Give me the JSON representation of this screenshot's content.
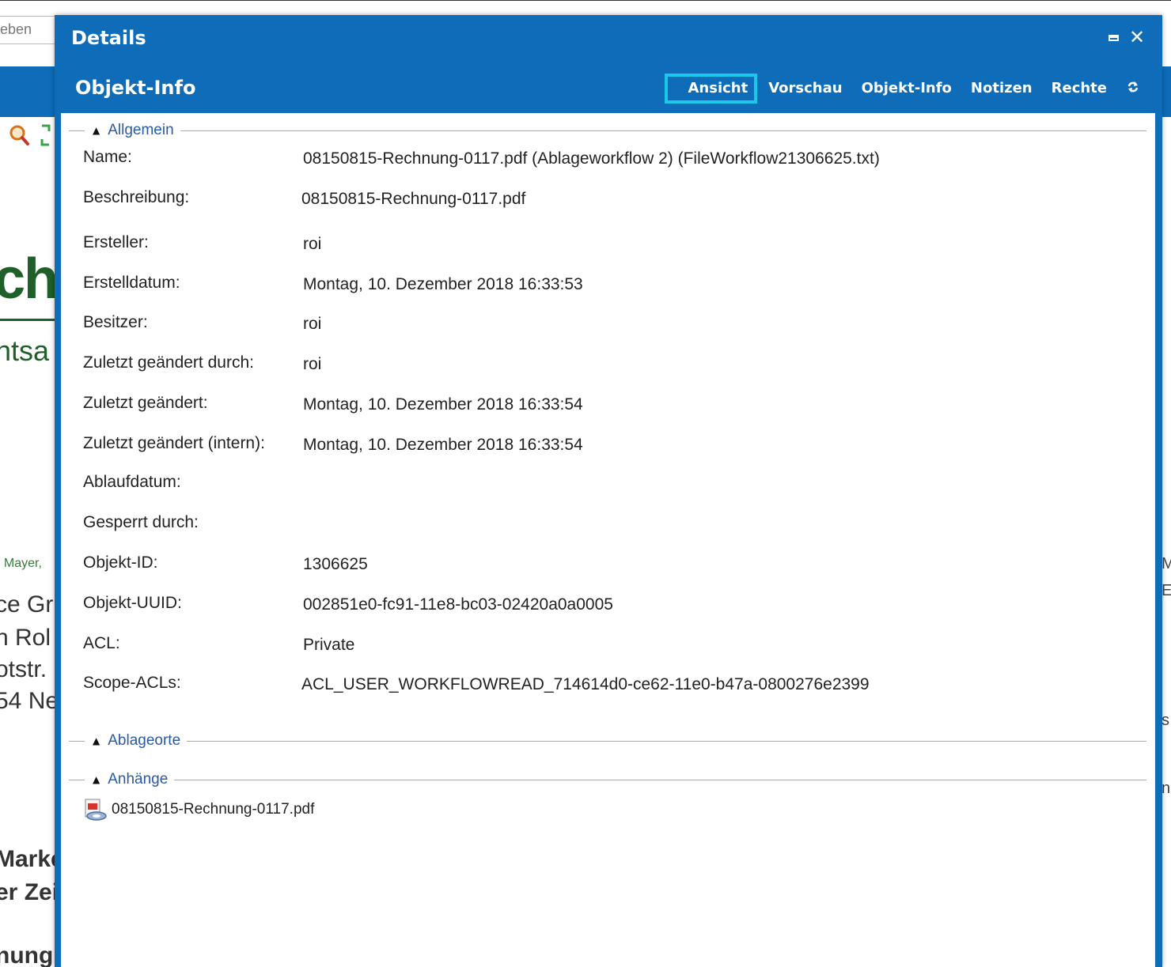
{
  "background": {
    "search_fragment": "eben",
    "doc_fragments": {
      "logo_big": "ch",
      "logo_sub": "htsa",
      "small_green": ", Mayer,",
      "addr1": "ce Gr",
      "addr2": "n Rol",
      "addr3": "otstr.",
      "addr4": "54 Ne",
      "bold1": "Marke",
      "bold2": "er Zei",
      "bold3": "nung"
    },
    "right_fragments": [
      "M",
      "E",
      "s",
      "n"
    ]
  },
  "dialog": {
    "title": "Details",
    "subheader_title": "Objekt-Info",
    "tabs": [
      "Ansicht",
      "Vorschau",
      "Objekt-Info",
      "Notizen",
      "Rechte"
    ],
    "active_tab": "Ansicht",
    "controls": {
      "maximize_icon": "maximize-icon",
      "close_icon": "close-icon",
      "refresh_icon": "refresh-icon"
    }
  },
  "sections": {
    "general": {
      "label": "Allgemein",
      "properties": [
        {
          "label": "Name:",
          "value": "08150815-Rechnung-0117.pdf (Ablageworkflow 2) (FileWorkflow21306625.txt)"
        },
        {
          "label": "Beschreibung:",
          "value": "08150815-Rechnung-0117.pdf"
        },
        {
          "label": "Ersteller:",
          "value": "roi"
        },
        {
          "label": "Erstelldatum:",
          "value": "Montag, 10. Dezember 2018 16:33:53"
        },
        {
          "label": "Besitzer:",
          "value": "roi"
        },
        {
          "label": "Zuletzt geändert durch:",
          "value": "roi"
        },
        {
          "label": "Zuletzt geändert:",
          "value": "Montag, 10. Dezember 2018 16:33:54"
        },
        {
          "label": "Zuletzt geändert (intern):",
          "value": "Montag, 10. Dezember 2018 16:33:54"
        },
        {
          "label": "Ablaufdatum:",
          "value": ""
        },
        {
          "label": "Gesperrt durch:",
          "value": ""
        },
        {
          "label": "Objekt-ID:",
          "value": "1306625"
        },
        {
          "label": "Objekt-UUID:",
          "value": "002851e0-fc91-11e8-bc03-02420a0a0005"
        },
        {
          "label": "ACL:",
          "value": "Private"
        },
        {
          "label": "Scope-ACLs:",
          "value": "ACL_USER_WORKFLOWREAD_714614d0-ce62-11e0-b47a-0800276e2399"
        }
      ]
    },
    "locations": {
      "label": "Ablageorte"
    },
    "attachments": {
      "label": "Anhänge",
      "items": [
        {
          "name": "08150815-Rechnung-0117.pdf",
          "icon": "pdf-file-icon"
        }
      ]
    }
  },
  "colors": {
    "accent_blue": "#0e6cb8",
    "active_tab_border": "#1cc8e8",
    "section_link": "#2a5aa6"
  }
}
